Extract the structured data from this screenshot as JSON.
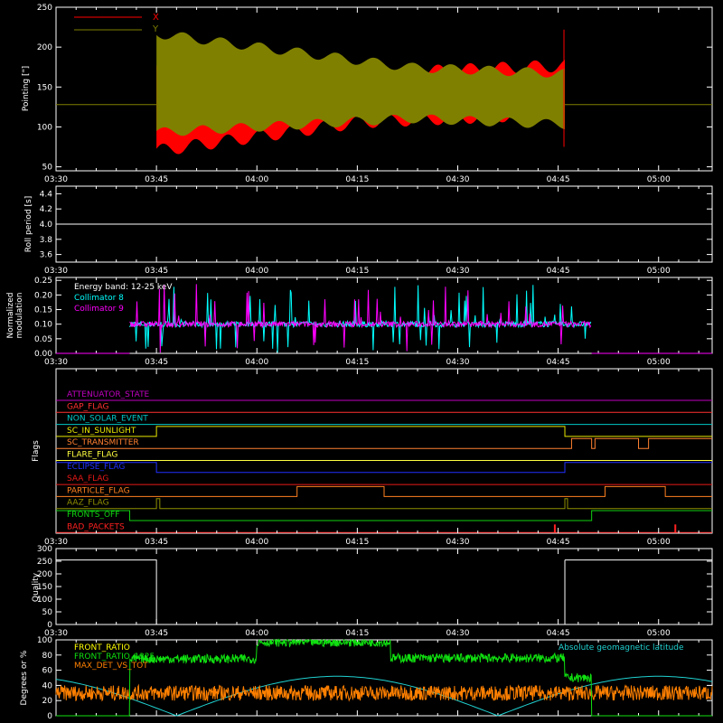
{
  "chart_data": [
    {
      "type": "line",
      "panel": "pointing",
      "ylabel": "Pointing [\"]",
      "ylim": [
        45,
        250
      ],
      "yticks": [
        50,
        100,
        150,
        200,
        250
      ],
      "xlim_min": [
        210,
        308
      ],
      "xticks": [
        "03:30",
        "03:45",
        "04:00",
        "04:15",
        "04:30",
        "04:45",
        "05:00"
      ],
      "legend": {
        "placement": "top-left"
      },
      "series": [
        {
          "name": "X",
          "color": "#ff0000"
        },
        {
          "name": "Y",
          "color": "#808000"
        }
      ],
      "baseline": 128,
      "active_range": [
        "03:45",
        "04:46"
      ]
    },
    {
      "type": "line",
      "panel": "roll",
      "ylabel": "Roll period [s]",
      "ylim": [
        3.5,
        4.5
      ],
      "yticks": [
        "3.6",
        "3.8",
        "4.0",
        "4.2",
        "4.4"
      ],
      "value": 4.0,
      "xticks": [
        "03:30",
        "03:45",
        "04:00",
        "04:15",
        "04:30",
        "04:45",
        "05:00"
      ]
    },
    {
      "type": "bar",
      "panel": "modulation",
      "ylabel": "Normalized\nmodulation",
      "ylim": [
        0,
        0.26
      ],
      "yticks": [
        "0.00",
        "0.05",
        "0.10",
        "0.15",
        "0.20",
        "0.25"
      ],
      "annotation": "Energy band: 12-25 keV",
      "series": [
        {
          "name": "Collimator 8",
          "color": "#00ffff"
        },
        {
          "name": "Collimator 9",
          "color": "#ff00ff"
        }
      ],
      "typical_value": 0.1,
      "active_range": [
        "03:41",
        "04:50"
      ],
      "xticks": [
        "03:30",
        "03:45",
        "04:00",
        "04:15",
        "04:30",
        "04:45",
        "05:00"
      ]
    },
    {
      "type": "line",
      "panel": "flags",
      "ylabel": "Flags",
      "flags": [
        {
          "name": "ATTENUATOR_STATE",
          "color": "#c000c0",
          "steps": []
        },
        {
          "name": "GAP_FLAG",
          "color": "#ff3030",
          "steps": []
        },
        {
          "name": "NON_SOLAR_EVENT",
          "color": "#00c8c8",
          "steps": []
        },
        {
          "name": "SC_IN_SUNLIGHT",
          "color": "#e8e800",
          "steps": [
            [
              210,
              0
            ],
            [
              225,
              1
            ],
            [
              286,
              0
            ]
          ]
        },
        {
          "name": "SC_TRANSMITTER",
          "color": "#ff8030",
          "steps": [
            [
              210,
              0
            ],
            [
              287,
              1
            ],
            [
              290,
              0
            ],
            [
              290.5,
              1
            ],
            [
              297,
              0
            ],
            [
              298.5,
              1
            ]
          ]
        },
        {
          "name": "FLARE_FLAG",
          "color": "#ffff40",
          "steps": []
        },
        {
          "name": "ECLIPSE_FLAG",
          "color": "#2030ff",
          "steps": [
            [
              210,
              1
            ],
            [
              225,
              0
            ],
            [
              286,
              1
            ]
          ]
        },
        {
          "name": "SAA_FLAG",
          "color": "#e81818",
          "steps": []
        },
        {
          "name": "PARTICLE_FLAG",
          "color": "#ff8020",
          "steps": [
            [
              210,
              0
            ],
            [
              246,
              1
            ],
            [
              259,
              0
            ],
            [
              292,
              1
            ],
            [
              301,
              0
            ]
          ]
        },
        {
          "name": "AAZ_FLAG",
          "color": "#909000",
          "steps": [
            [
              210,
              0
            ],
            [
              225,
              1
            ],
            [
              225.5,
              0
            ],
            [
              286,
              1
            ],
            [
              286.4,
              0
            ]
          ]
        },
        {
          "name": "FRONTS_OFF",
          "color": "#10d010",
          "steps": [
            [
              210,
              1
            ],
            [
              221,
              0
            ],
            [
              290,
              1
            ]
          ]
        },
        {
          "name": "BAD_PACKETS",
          "color": "#ff2020",
          "steps": [],
          "spikes": [
            284.5,
            302.5
          ]
        }
      ],
      "xticks": [
        "03:30",
        "03:45",
        "04:00",
        "04:15",
        "04:30",
        "04:45",
        "05:00"
      ]
    },
    {
      "type": "line",
      "panel": "quality",
      "ylabel": "Quality",
      "ylim": [
        0,
        300
      ],
      "yticks": [
        "0",
        "50",
        "100",
        "150",
        "200",
        "250",
        "300"
      ],
      "segments": [
        {
          "from": "03:30",
          "to": "03:45",
          "value": 255
        },
        {
          "from": "04:46",
          "to": "05:08",
          "value": 255
        }
      ],
      "xticks": [
        "03:30",
        "03:45",
        "04:00",
        "04:15",
        "04:30",
        "04:45",
        "05:00"
      ]
    },
    {
      "type": "line",
      "panel": "ratios",
      "ylabel": "Degrees or %",
      "ylim": [
        0,
        100
      ],
      "yticks": [
        "0",
        "20",
        "40",
        "60",
        "80",
        "100"
      ],
      "series": [
        {
          "name": "FRONT_RATIO",
          "color": "#ffff00"
        },
        {
          "name": "FRONT_RATIO_1325",
          "color": "#10e010"
        },
        {
          "name": "MAX_DET_VS_TOT",
          "color": "#ff8000"
        }
      ],
      "annotation": "Absolute geomagnetic latitude",
      "annotation_color": "#20d0d0",
      "xticks": []
    }
  ]
}
